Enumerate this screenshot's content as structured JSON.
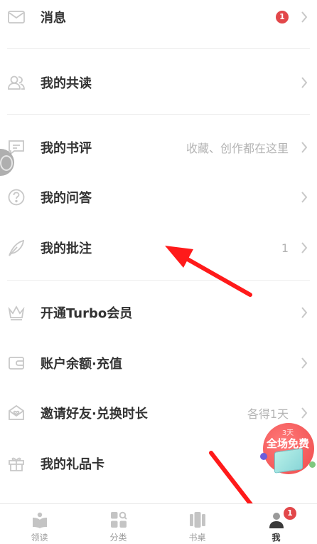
{
  "menu": {
    "messages": {
      "label": "消息",
      "badge": "1",
      "icon": "mail-icon"
    },
    "co_reading": {
      "label": "我的共读",
      "icon": "people-icon"
    },
    "reviews": {
      "label": "我的书评",
      "hint": "收藏、创作都在这里",
      "icon": "comment-icon"
    },
    "qa": {
      "label": "我的问答",
      "icon": "question-icon"
    },
    "annotations": {
      "label": "我的批注",
      "count": "1",
      "icon": "feather-icon"
    },
    "turbo": {
      "label": "开通Turbo会员",
      "icon": "crown-icon"
    },
    "balance": {
      "label": "账户余额·充值",
      "icon": "wallet-icon"
    },
    "invite": {
      "label": "邀请好友·兑换时长",
      "hint": "各得1天",
      "icon": "envelope-heart-icon"
    },
    "gift_card": {
      "label": "我的礼品卡",
      "icon": "gift-icon"
    }
  },
  "promo": {
    "days": "3天",
    "text": "全场免费"
  },
  "tabbar": {
    "tabs": [
      {
        "label": "领读",
        "icon": "book-open-icon"
      },
      {
        "label": "分类",
        "icon": "category-icon"
      },
      {
        "label": "书桌",
        "icon": "bookshelf-icon"
      },
      {
        "label": "我",
        "icon": "user-icon",
        "badge": "1",
        "active": true
      }
    ]
  },
  "colors": {
    "accent": "#e2474a",
    "arrow": "#ff1a1a",
    "text": "#333333",
    "muted": "#b4b4b4"
  }
}
